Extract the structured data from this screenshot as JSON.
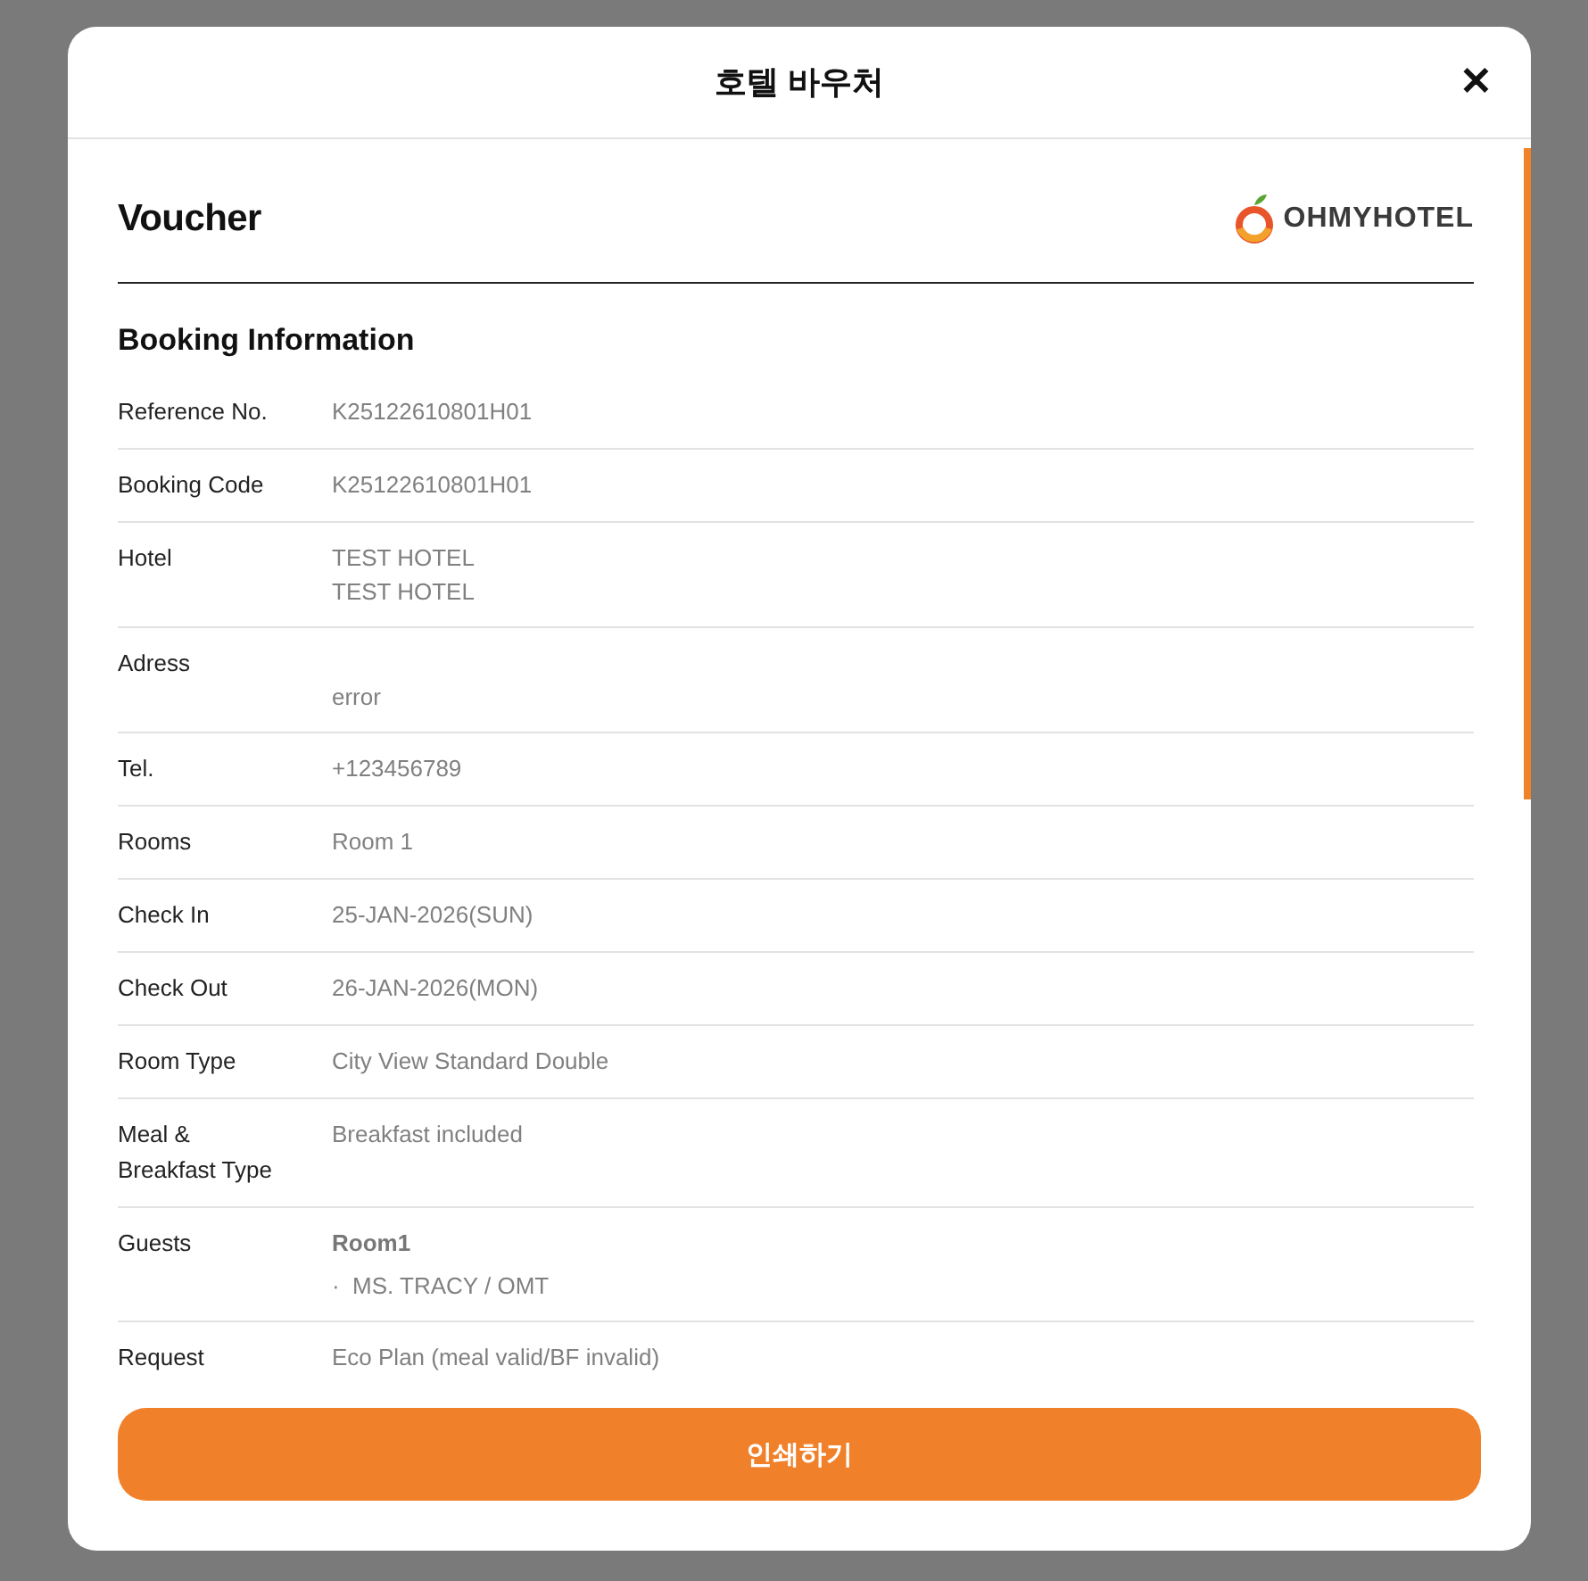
{
  "dialog": {
    "title": "호텔 바우처",
    "close": "✕"
  },
  "voucher": {
    "title": "Voucher",
    "logo_text": "OHMYHOTEL"
  },
  "section": {
    "title": "Booking Information"
  },
  "rows": [
    {
      "label": "Reference No.",
      "values": [
        "K25122610801H01"
      ]
    },
    {
      "label": "Booking Code",
      "values": [
        "K25122610801H01"
      ]
    },
    {
      "label": "Hotel",
      "values": [
        "TEST HOTEL",
        "TEST HOTEL"
      ]
    },
    {
      "label": "Adress",
      "kind": "offset",
      "values": [
        "error"
      ]
    },
    {
      "label": "Tel.",
      "values": [
        "+123456789"
      ]
    },
    {
      "label": "Rooms",
      "values": [
        "Room 1"
      ]
    },
    {
      "label": "Check In",
      "values": [
        "25-JAN-2026(SUN)"
      ]
    },
    {
      "label": "Check Out",
      "values": [
        "26-JAN-2026(MON)"
      ]
    },
    {
      "label": "Room Type",
      "values": [
        "City View Standard Double"
      ]
    },
    {
      "label": "Meal & Breakfast Type",
      "values": [
        "Breakfast included"
      ]
    },
    {
      "label": "Guests",
      "room": "Room1",
      "guests": [
        "·  MS. TRACY / OMT"
      ]
    },
    {
      "label": "Request",
      "values": [
        "Eco Plan (meal valid/BF invalid)"
      ]
    }
  ],
  "print_button": "인쇄하기"
}
